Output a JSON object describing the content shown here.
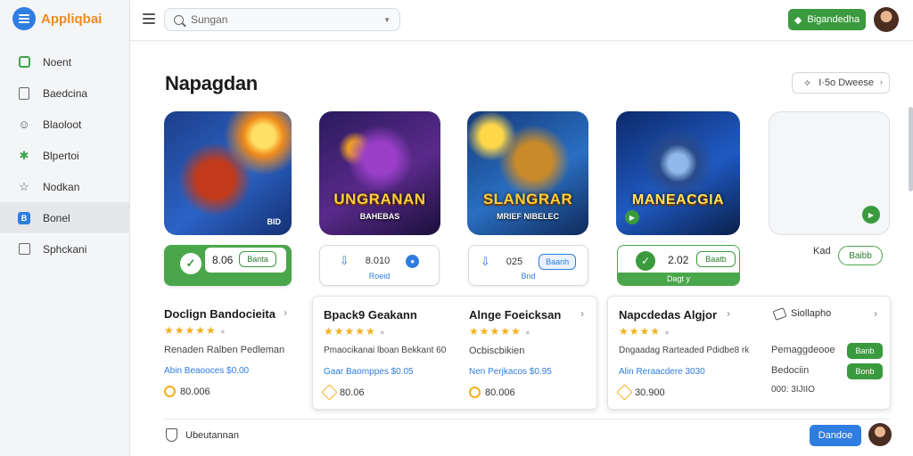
{
  "app": {
    "name": "Appliqbai"
  },
  "sidebar": {
    "items": [
      {
        "label": "Noent",
        "icon": "home-icon"
      },
      {
        "label": "Baedcina",
        "icon": "document-icon"
      },
      {
        "label": "Blaoloot",
        "icon": "gamepad-icon"
      },
      {
        "label": "Blpertoi",
        "icon": "puzzle-icon"
      },
      {
        "label": "Nodkan",
        "icon": "star-icon"
      },
      {
        "label": "Bonel",
        "icon": "bookmark-icon"
      },
      {
        "label": "Sphckani",
        "icon": "settings-icon"
      }
    ],
    "active_index": 5
  },
  "topbar": {
    "search_placeholder": "Sungan",
    "action_label": "Bigandedha"
  },
  "page": {
    "title": "Napagdan",
    "sort_label": "I·5o  Dweese"
  },
  "games": [
    {
      "art_title": "",
      "art_sub": "",
      "corner": "BID"
    },
    {
      "art_title": "UNGRANAN",
      "art_sub": "BAHEBAS",
      "corner": ""
    },
    {
      "art_title": "SLANGRAR",
      "art_sub": "MRIEF NIBELEC",
      "corner": ""
    },
    {
      "art_title": "MANEACGIA",
      "art_sub": "",
      "corner": ""
    },
    {
      "art_title": "",
      "art_sub": "",
      "corner": ""
    }
  ],
  "install": [
    {
      "value": "8.06",
      "button": "Banta"
    },
    {
      "value": "8.010",
      "sub": "Roeid"
    },
    {
      "value": "025",
      "button": "Baanh",
      "sub": "Bnd"
    },
    {
      "value": "2.02",
      "button": "Baatb",
      "footer": "Dagt y"
    },
    {
      "label": "Kad",
      "button": "Baibb"
    }
  ],
  "cards": [
    {
      "title": "Doclign Bandocieita",
      "desc": "Renaden Ralben Pedleman",
      "link": "Abin Beaooces $0.00",
      "meta": "80.006"
    },
    {
      "title": "Bpack9 Geakann",
      "desc": "Pmaocikanai lboan Bekkant 60",
      "link": "Gaar Baomppes $0.05",
      "meta": "80.06"
    },
    {
      "title": "Alnge Foeicksan",
      "desc": "Ocbiscbikien",
      "link": "Nen Perjkacos $0.95",
      "meta": "80.006"
    },
    {
      "title": "Napcdedas Algjor",
      "desc": "Dngaadag Rarteaded Pdidbe8 rk",
      "link": "Alin Reraacdere 3030",
      "meta": "30.900"
    },
    {
      "title": "Siollapho",
      "rows": [
        {
          "label": "Pemaggdeooe",
          "button": "Banb"
        },
        {
          "label": "Bedociin",
          "button": "Bonb"
        },
        {
          "label": "000: 3IJIIO"
        }
      ]
    }
  ],
  "footer": {
    "text": "Ubeutannan",
    "button": "Dandoe"
  }
}
